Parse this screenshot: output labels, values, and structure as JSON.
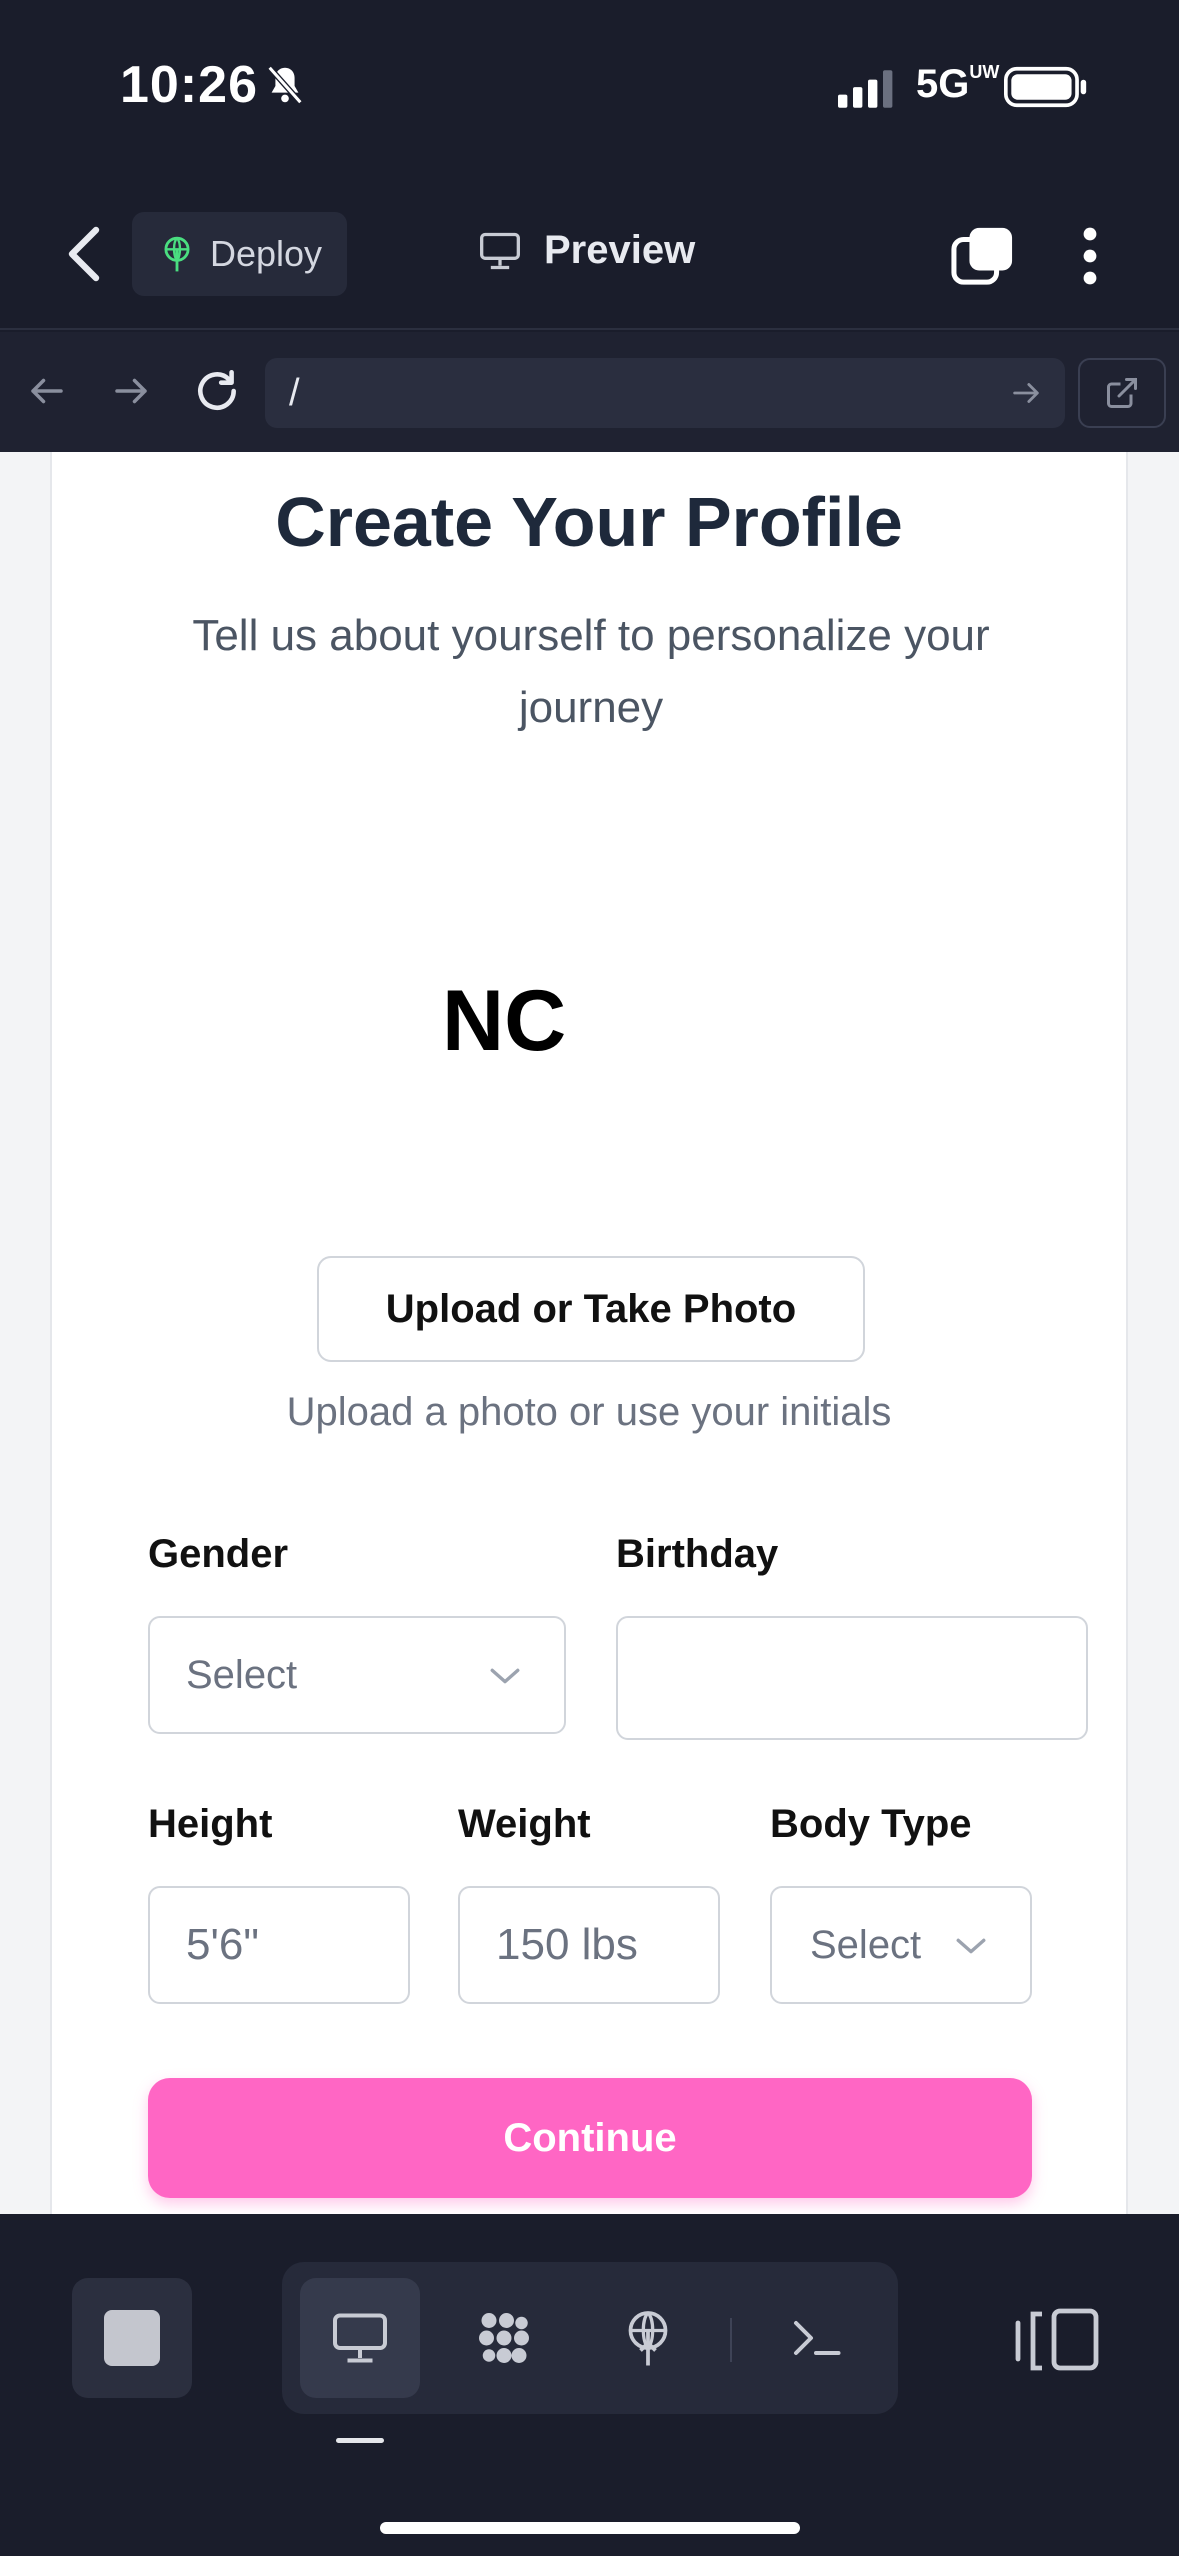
{
  "status_bar": {
    "time": "10:26",
    "network": "5G",
    "network_suffix": "UW"
  },
  "app_bar": {
    "deploy_label": "Deploy",
    "title": "Preview"
  },
  "url_bar": {
    "url": "/"
  },
  "profile": {
    "title": "Create Your Profile",
    "subtitle": "Tell us about yourself to personalize your journey",
    "initials": "NC",
    "upload_label": "Upload or Take Photo",
    "upload_hint": "Upload a photo or use your initials",
    "fields": {
      "gender": {
        "label": "Gender",
        "value": "Select"
      },
      "birthday": {
        "label": "Birthday",
        "value": ""
      },
      "height": {
        "label": "Height",
        "placeholder": "5'6\""
      },
      "weight": {
        "label": "Weight",
        "placeholder": "150 lbs"
      },
      "body_type": {
        "label": "Body Type",
        "value": "Select"
      }
    },
    "continue_label": "Continue"
  },
  "colors": {
    "accent": "#ff66c4",
    "chrome_bg": "#1a1d2b",
    "title_text": "#1e293b"
  },
  "bottom_bar": {
    "icons": [
      "stop-icon",
      "desktop-icon",
      "apps-icon",
      "deploy-icon",
      "terminal-icon",
      "layout-icon"
    ]
  }
}
